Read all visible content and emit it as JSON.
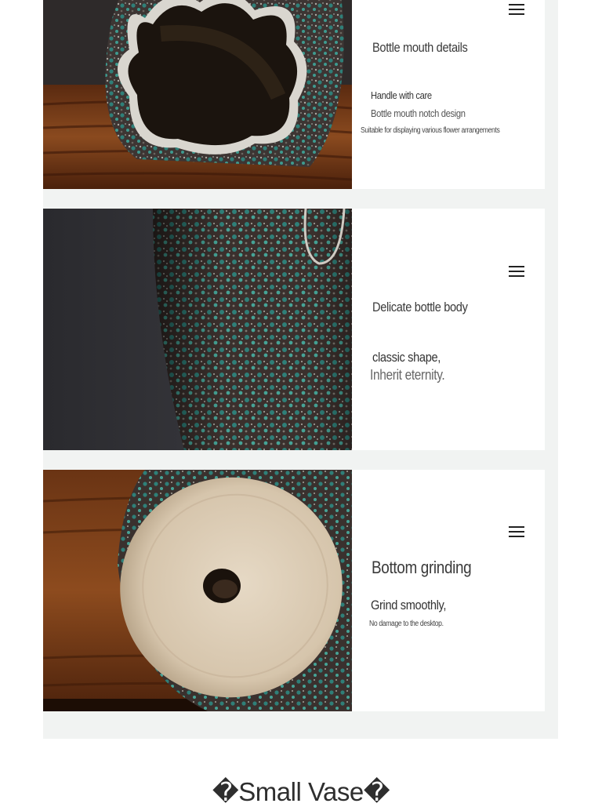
{
  "sections": [
    {
      "photo_alt": "bottle-mouth-photo",
      "title": "Bottle mouth details",
      "lines": [
        "Handle with care",
        "Bottle mouth notch design",
        "Suitable for displaying various flower arrangements"
      ]
    },
    {
      "photo_alt": "bottle-body-photo",
      "title": "Delicate bottle body",
      "lines": [
        "classic shape,",
        "Inherit eternity."
      ]
    },
    {
      "photo_alt": "bottle-bottom-photo",
      "title": "Bottom grinding",
      "lines": [
        "Grind smoothly,",
        "No damage to the desktop."
      ]
    }
  ],
  "footer_heading": "�Small Vase�",
  "colors": {
    "panel_background": "#f1f3f2",
    "card_background": "#ffffff",
    "glaze_teal": "#2f7f78",
    "glaze_dark": "#3a2f2c",
    "wood": "#7a3a16"
  }
}
